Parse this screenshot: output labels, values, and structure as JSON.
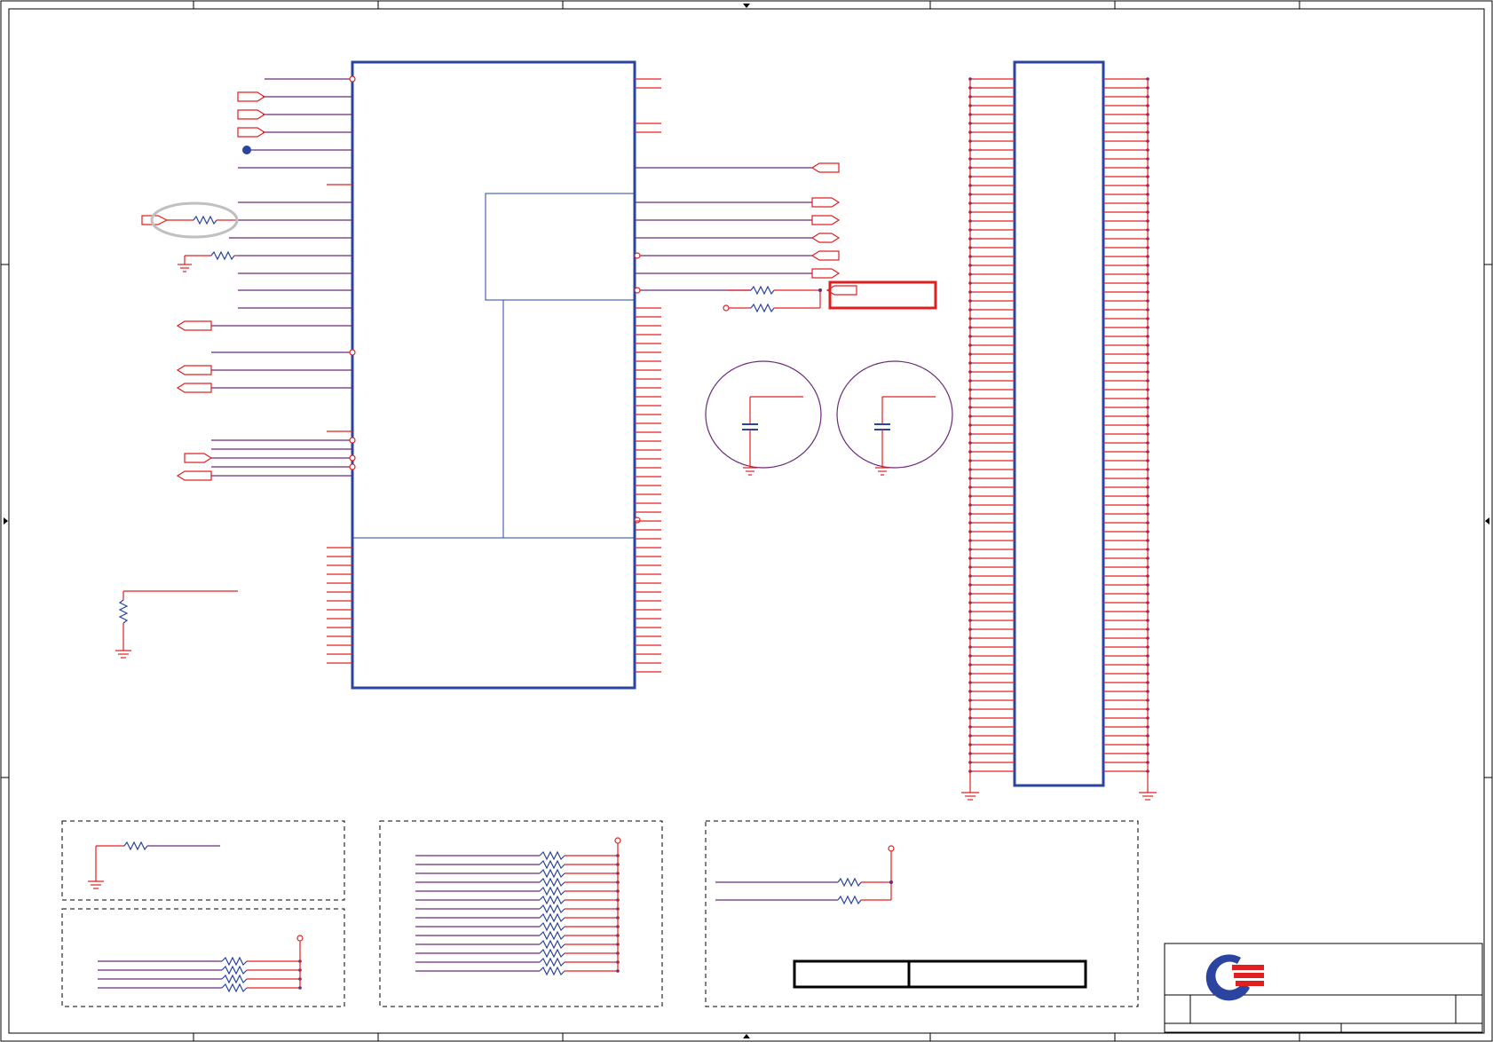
{
  "sheet": {
    "border_color": "#000000",
    "wire_color": "#e02020",
    "net_color": "#6b2a7a",
    "part_color": "#2a44a0",
    "highlight_color": "#e02020",
    "callout_color": "#c0c0c0",
    "logo_colors": [
      "#2a44a0",
      "#e02020"
    ]
  },
  "components": {
    "main_ic": {
      "type": "ic-symbol"
    },
    "connector": {
      "type": "connector-symbol"
    },
    "capacitors": [
      {
        "type": "capacitor"
      },
      {
        "type": "capacitor"
      }
    ]
  },
  "title_block": {
    "logo": "logo-icon"
  }
}
